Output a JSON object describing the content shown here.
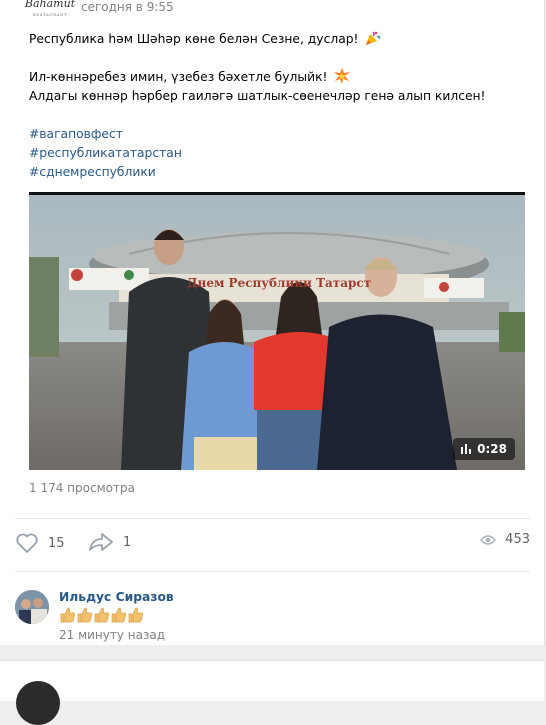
{
  "post": {
    "timestamp": "сегодня в 9:55",
    "logo_text": "Bahamut",
    "logo_subtext": "RESTAURANT",
    "lines": [
      "Республика һәм Шәһәр көне белән Сезне, дуслар!",
      "Ил-көннәребез имин, үзебез бәхетле булыйк!",
      "Алдагы көннәр һәрбер гаиләгә шатлык-сөенечләр генә алып килсен!"
    ],
    "hashtags": [
      "#вагаповфест",
      "#республикататарстан",
      "#сднемреспублики"
    ],
    "emojis": [
      "party-popper",
      "collision"
    ]
  },
  "video": {
    "banner_text": "Днем Республики Татарст",
    "duration": "0:28"
  },
  "views_label": "1 174 просмотра",
  "actions": {
    "likes": "15",
    "shares": "1",
    "views": "453"
  },
  "comment": {
    "author": "Ильдус Сиразов",
    "reaction": "thumbs-up ×5",
    "time": "21 минуту назад"
  },
  "colors": {
    "link": "#2a5885",
    "muted": "#828282",
    "background": "#edeef0"
  }
}
